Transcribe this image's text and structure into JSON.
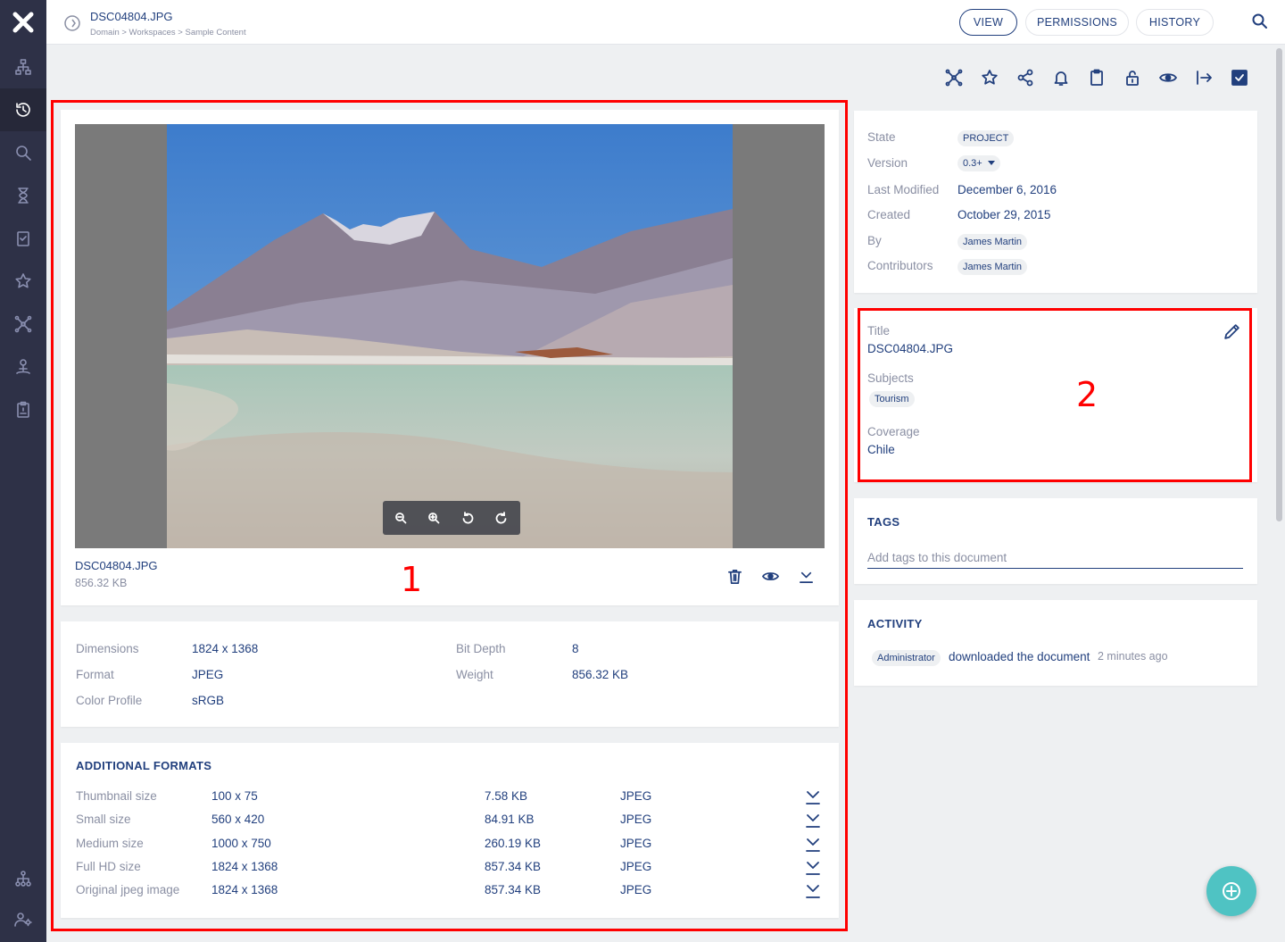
{
  "header": {
    "doc_title": "DSC04804.JPG",
    "breadcrumb": "Domain > Workspaces > Sample Content",
    "tabs": [
      "VIEW",
      "PERMISSIONS",
      "HISTORY"
    ],
    "active_tab": "VIEW"
  },
  "sidebar": {
    "items": [
      "browse-tree-icon",
      "history-icon",
      "search-icon",
      "hourglass-icon",
      "tasks-icon",
      "favorites-icon",
      "collections-icon",
      "personal-workspace-icon",
      "clipboard-icon",
      "admin-tree-icon",
      "user-settings-icon"
    ],
    "active": "history-icon"
  },
  "actions": [
    "collections-icon",
    "star-icon",
    "share-icon",
    "bell-icon",
    "clipboard-icon",
    "unlock-icon",
    "eye-icon",
    "export-icon",
    "checkbox-icon"
  ],
  "viewer": {
    "file_name": "DSC04804.JPG",
    "file_size": "856.32 KB",
    "marker": "1"
  },
  "properties": {
    "dimensions_label": "Dimensions",
    "dimensions": "1824 x 1368",
    "format_label": "Format",
    "format": "JPEG",
    "color_profile_label": "Color Profile",
    "color_profile": "sRGB",
    "bit_depth_label": "Bit Depth",
    "bit_depth": "8",
    "weight_label": "Weight",
    "weight": "856.32 KB"
  },
  "additional_formats": {
    "heading": "ADDITIONAL FORMATS",
    "rows": [
      {
        "name": "Thumbnail size",
        "dims": "100 x 75",
        "size": "7.58 KB",
        "format": "JPEG"
      },
      {
        "name": "Small size",
        "dims": "560 x 420",
        "size": "84.91 KB",
        "format": "JPEG"
      },
      {
        "name": "Medium size",
        "dims": "1000 x 750",
        "size": "260.19 KB",
        "format": "JPEG"
      },
      {
        "name": "Full HD size",
        "dims": "1824 x 1368",
        "size": "857.34 KB",
        "format": "JPEG"
      },
      {
        "name": "Original jpeg image",
        "dims": "1824 x 1368",
        "size": "857.34 KB",
        "format": "JPEG"
      }
    ]
  },
  "info": {
    "state_label": "State",
    "state": "PROJECT",
    "version_label": "Version",
    "version": "0.3+",
    "last_modified_label": "Last Modified",
    "last_modified": "December 6, 2016",
    "created_label": "Created",
    "created": "October 29, 2015",
    "by_label": "By",
    "by": "James Martin",
    "contributors_label": "Contributors",
    "contributors": "James Martin"
  },
  "metadata": {
    "title_label": "Title",
    "title": "DSC04804.JPG",
    "subjects_label": "Subjects",
    "subject": "Tourism",
    "coverage_label": "Coverage",
    "coverage": "Chile",
    "marker": "2"
  },
  "tags": {
    "heading": "TAGS",
    "placeholder": "Add tags to this document"
  },
  "activity": {
    "heading": "ACTIVITY",
    "user": "Administrator",
    "action": "downloaded the document",
    "time": "2 minutes ago"
  },
  "colors": {
    "brand_dark": "#2e3147",
    "text_primary": "#213f7d",
    "accent_fab": "#4fc3c3",
    "highlight": "#ff0000"
  }
}
